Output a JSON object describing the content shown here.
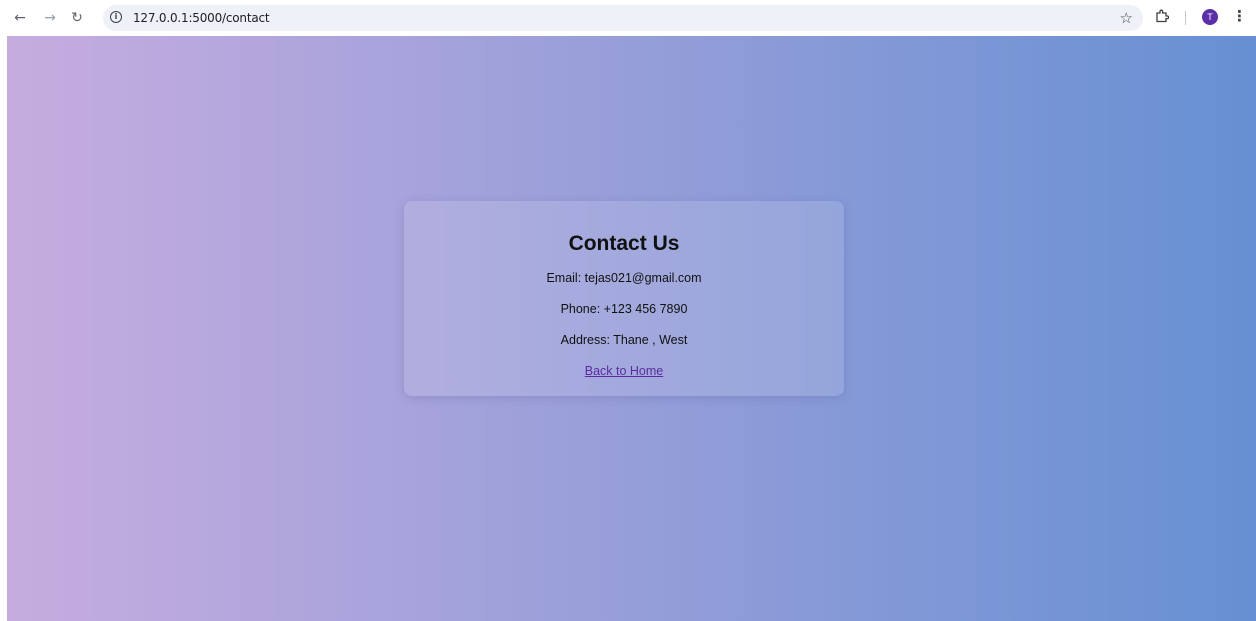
{
  "browser": {
    "url": "127.0.0.1:5000/contact",
    "avatar_initial": "T",
    "icons": [
      "back-arrow-icon",
      "forward-arrow-icon",
      "reload-icon",
      "site-info-icon",
      "bookmark-star-icon",
      "extensions-icon",
      "menu-dots-icon"
    ]
  },
  "page": {
    "heading": "Contact Us",
    "email_line": "Email: tejas021@gmail.com",
    "phone_line": "Phone: +123 456 7890",
    "address_line": "Address: Thane , West",
    "back_link": "Back to Home"
  },
  "colors": {
    "gradient_start": "#c6acdf",
    "gradient_end": "#6690d3",
    "link": "#5b2ca0",
    "avatar": "#5b2fa8"
  }
}
